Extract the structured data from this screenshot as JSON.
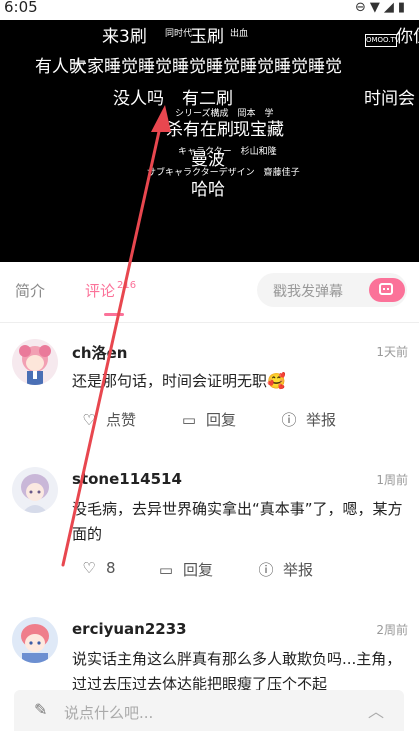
{
  "status_bar": {
    "time": "6:05",
    "icons": [
      "minus-circle-icon",
      "wifi-icon",
      "signal-icon",
      "battery-icon"
    ]
  },
  "video": {
    "logo_text": "OMOO.TV",
    "danmaku": [
      "来3刷",
      "同时代",
      "玉刷",
      "出血",
      "你住",
      "有人吹",
      "大家睡觉睡觉睡觉睡觉睡觉睡觉睡觉",
      "没人吗",
      "有二刷",
      "时间会",
      "杀有在刷",
      "现宝藏",
      "曼波",
      "哈哈"
    ],
    "credits": [
      "シリーズ構成　岡本　学",
      "キャラクター　杉山和隆",
      "サブキャラクターデザイン　齋藤佳子"
    ]
  },
  "tabs": {
    "intro": "简介",
    "comments": "评论",
    "comments_count": "216"
  },
  "danmaku_input": {
    "placeholder": "戳我发弹幕"
  },
  "comments": [
    {
      "user": "ch洛en",
      "time": "1天前",
      "text": "还是那句话，时间会证明无职🥰",
      "like_label": "点赞",
      "reply_label": "回复",
      "report_label": "举报"
    },
    {
      "user": "stone114514",
      "time": "1周前",
      "text": "没毛病，去异世界确实拿出“真本事”了，嗯，某方面的",
      "like_label": "8",
      "reply_label": "回复",
      "report_label": "举报"
    },
    {
      "user": "erciyuan2233",
      "time": "2周前",
      "text": "说实话主角这么胖真有那么多人敢欺负吗...主角，过过去压过去体达能把眼瘦了压个不起"
    }
  ],
  "bottom_input": {
    "placeholder": "说点什么吧..."
  },
  "colors": {
    "accent": "#fb7299",
    "annotation_arrow": "#e8474f"
  }
}
